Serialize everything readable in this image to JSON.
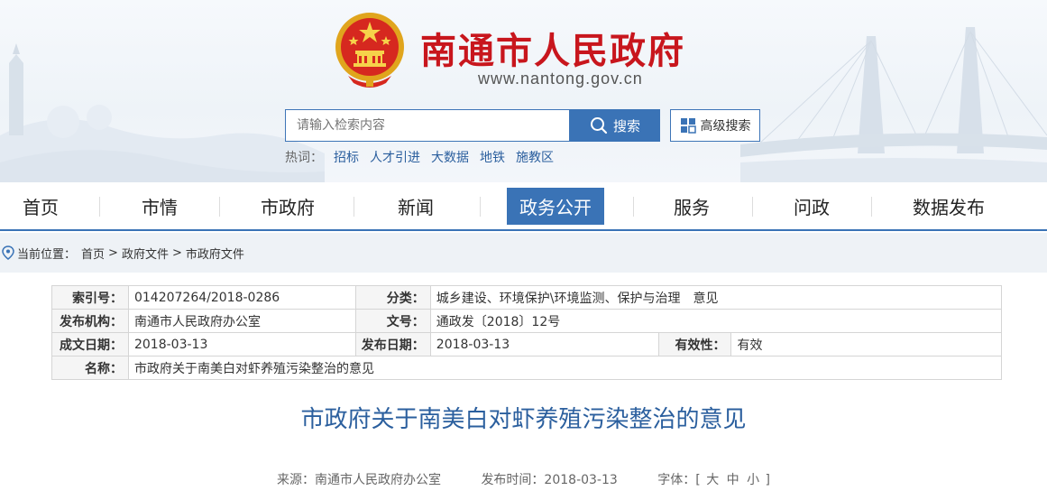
{
  "header": {
    "site_title": "南通市人民政府",
    "site_url": "www.nantong.gov.cn",
    "search": {
      "placeholder": "请输入检索内容",
      "button_label": "搜索",
      "advanced_label": "高级搜索"
    },
    "hotwords": {
      "label": "热词：",
      "items": [
        "招标",
        "人才引进",
        "大数据",
        "地铁",
        "施教区"
      ]
    }
  },
  "nav": {
    "items": [
      "首页",
      "市情",
      "市政府",
      "新闻",
      "政务公开",
      "服务",
      "问政",
      "数据发布"
    ],
    "active": "政务公开"
  },
  "breadcrumb": {
    "label": "当前位置：",
    "items": [
      "首页",
      "政府文件",
      "市政府文件"
    ]
  },
  "info": {
    "index_key": "索引号：",
    "index_val": "014207264/2018-0286",
    "category_key": "分类：",
    "category_val": "城乡建设、环境保护\\环境监测、保护与治理　意见",
    "publisher_key": "发布机构：",
    "publisher_val": "南通市人民政府办公室",
    "docno_key": "文号：",
    "docno_val": "通政发〔2018〕12号",
    "created_key": "成文日期：",
    "created_val": "2018-03-13",
    "published_key": "发布日期：",
    "published_val": "2018-03-13",
    "validity_key": "有效性：",
    "validity_val": "有效",
    "name_key": "名称：",
    "name_val": "市政府关于南美白对虾养殖污染整治的意见"
  },
  "article": {
    "title": "市政府关于南美白对虾养殖污染整治的意见",
    "source": "来源：南通市人民政府办公室",
    "pubtime": "发布时间：2018-03-13",
    "font_label": "字体：[",
    "font_sizes": [
      "大",
      "中",
      "小"
    ],
    "font_end": "]"
  },
  "colors": {
    "brand_red": "#c8161d",
    "accent_blue": "#3a73b6",
    "link_blue": "#2b5f9e"
  }
}
